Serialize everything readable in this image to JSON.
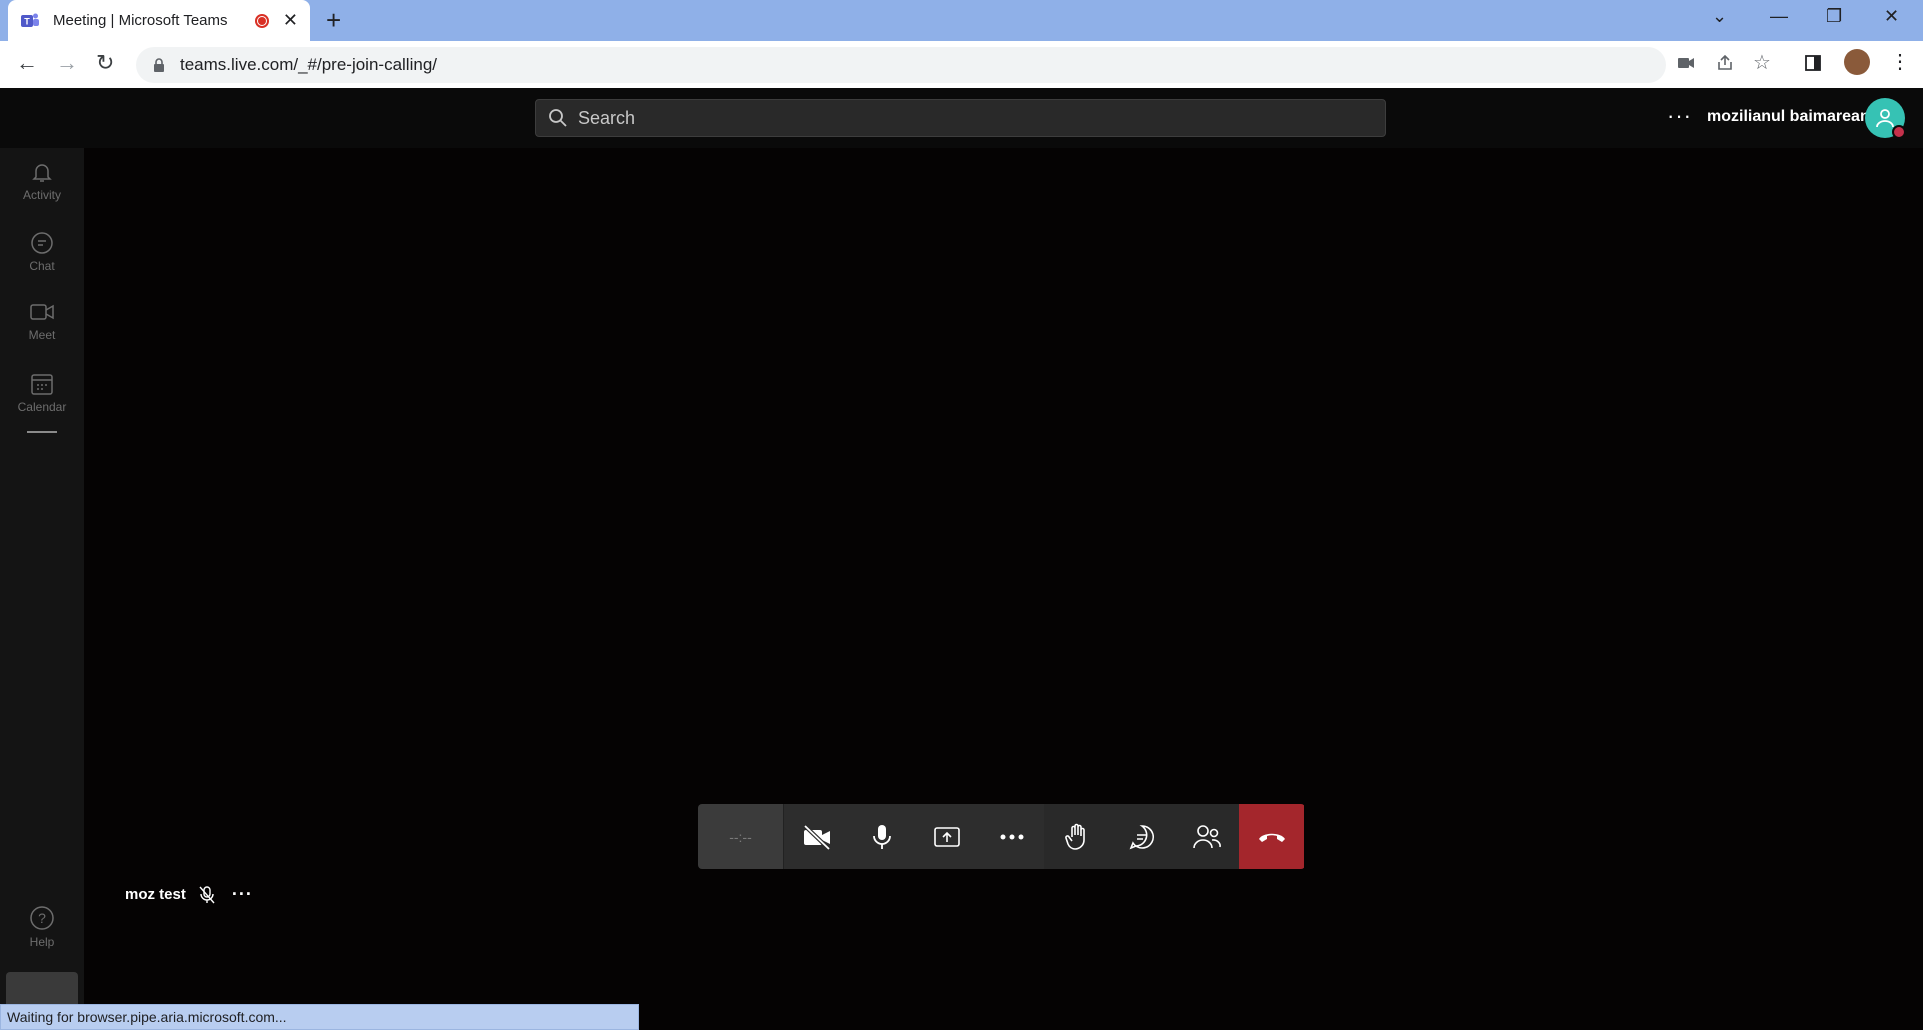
{
  "browser": {
    "tab_title": "Meeting | Microsoft Teams",
    "url": "teams.live.com/_#/pre-join-calling/",
    "status_text": "Waiting for browser.pipe.aria.microsoft.com..."
  },
  "teams": {
    "search_placeholder": "Search",
    "more_label": "···",
    "user_name": "mozilianul baimarean",
    "rail": [
      {
        "label": "Activity",
        "icon": "bell-icon"
      },
      {
        "label": "Chat",
        "icon": "chat-icon"
      },
      {
        "label": "Meet",
        "icon": "video-icon"
      },
      {
        "label": "Calendar",
        "icon": "calendar-icon"
      }
    ],
    "help_label": "Help",
    "meeting": {
      "timer": "--:--",
      "participant_name": "moz test",
      "participant_more": "···"
    }
  },
  "colors": {
    "accent_hangup": "#a4262c",
    "avatar": "#36c2b4",
    "presence_busy": "#c4314b",
    "browser_frame": "#8fb0e8"
  }
}
